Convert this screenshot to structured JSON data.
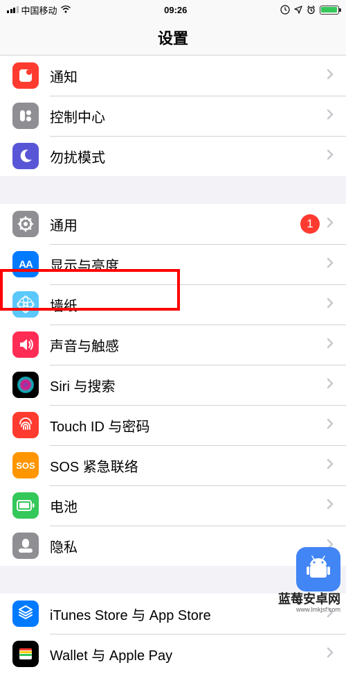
{
  "statusBar": {
    "carrier": "中国移动",
    "time": "09:26"
  },
  "navTitle": "设置",
  "groups": [
    {
      "rows": [
        {
          "id": "notifications",
          "label": "通知",
          "iconBg": "#ff3b30"
        },
        {
          "id": "control-center",
          "label": "控制中心",
          "iconBg": "#8e8e93"
        },
        {
          "id": "dnd",
          "label": "勿扰模式",
          "iconBg": "#5856d6"
        }
      ]
    },
    {
      "rows": [
        {
          "id": "general",
          "label": "通用",
          "iconBg": "#8e8e93",
          "badge": "1"
        },
        {
          "id": "display",
          "label": "显示与亮度",
          "iconBg": "#007aff"
        },
        {
          "id": "wallpaper",
          "label": "墙纸",
          "iconBg": "#5ac8fa",
          "highlighted": true
        },
        {
          "id": "sounds",
          "label": "声音与触感",
          "iconBg": "#ff2d55"
        },
        {
          "id": "siri",
          "label": "Siri 与搜索",
          "iconBg": "#000000"
        },
        {
          "id": "touchid",
          "label": "Touch ID 与密码",
          "iconBg": "#ff3b30"
        },
        {
          "id": "sos",
          "label": "SOS 紧急联络",
          "iconBg": "#ff9500",
          "iconText": "SOS"
        },
        {
          "id": "battery",
          "label": "电池",
          "iconBg": "#34c759"
        },
        {
          "id": "privacy",
          "label": "隐私",
          "iconBg": "#8e8e93"
        }
      ]
    },
    {
      "rows": [
        {
          "id": "itunes",
          "label": "iTunes Store 与 App Store",
          "iconBg": "#007aff"
        },
        {
          "id": "wallet",
          "label": "Wallet 与 Apple Pay",
          "iconBg": "#000000"
        }
      ]
    }
  ],
  "watermark": {
    "title": "蓝莓安卓网",
    "url": "www.lmkjsf.com"
  }
}
